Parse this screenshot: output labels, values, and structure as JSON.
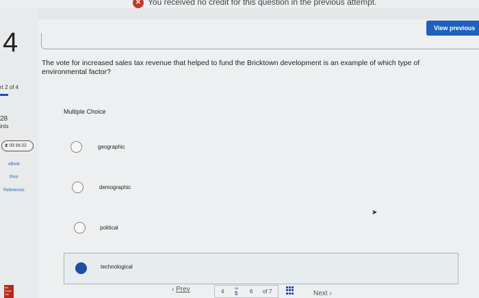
{
  "banner": {
    "text": "You received no credit for this question in the previous attempt.",
    "icon": "x-icon"
  },
  "sidebar": {
    "question_number": "4",
    "part": "rt 2 of 4",
    "points_value": "28",
    "points_label": "ints",
    "timer": "03:16:22",
    "links": [
      "eBook",
      "Print",
      "References"
    ],
    "logo_text": "Mc Graw Hill"
  },
  "header": {
    "view_previous": "View previous"
  },
  "question": {
    "text": "The vote for increased sales tax revenue that helped to fund the Bricktown development is an example of which type of environmental factor?",
    "type_label": "Multiple Choice",
    "options": [
      {
        "label": "geographic",
        "selected": false
      },
      {
        "label": "demographic",
        "selected": false
      },
      {
        "label": "political",
        "selected": false
      },
      {
        "label": "technological",
        "selected": true
      }
    ]
  },
  "nav": {
    "prev": "Prev",
    "pages": [
      "4",
      "5",
      "6"
    ],
    "current_page": "5",
    "of_total": "of 7",
    "next": "Next"
  },
  "colors": {
    "accent": "#1f5fbf",
    "selected_radio": "#1d4fa3",
    "error": "#c0392b"
  }
}
